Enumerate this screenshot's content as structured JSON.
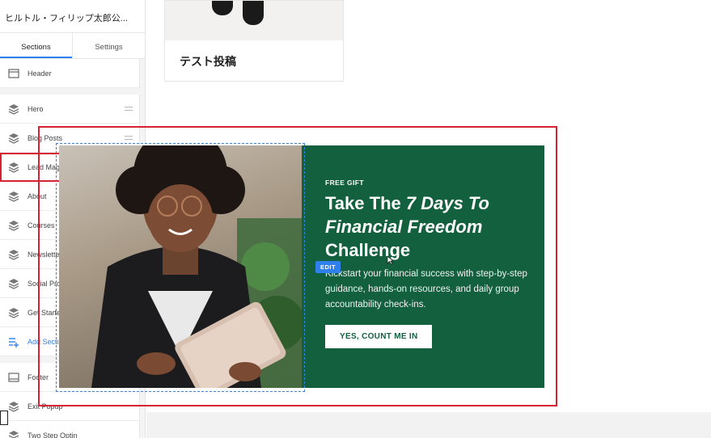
{
  "site": {
    "title": "ヒルトル・フィリップ太郎公..."
  },
  "tabs": [
    {
      "label": "Sections",
      "active": true
    },
    {
      "label": "Settings",
      "active": false
    }
  ],
  "sections": {
    "header": {
      "label": "Header"
    },
    "body": [
      {
        "label": "Hero",
        "hidden": false
      },
      {
        "label": "Blog Posts",
        "hidden": false
      },
      {
        "label": "Lead Magnet",
        "hidden": false,
        "selected": true
      },
      {
        "label": "About",
        "hidden": false
      },
      {
        "label": "Courses",
        "hidden": false
      },
      {
        "label": "Newsletter Opt-In",
        "hidden": false
      },
      {
        "label": "Social Proof Logos",
        "hidden": true
      },
      {
        "label": "Get Started",
        "hidden": true
      }
    ],
    "add_label": "Add Section",
    "footer": [
      {
        "label": "Footer"
      },
      {
        "label": "Exit Popup"
      },
      {
        "label": "Two Step Optin"
      }
    ]
  },
  "canvas": {
    "post_title": "テスト投稿",
    "lead_magnet": {
      "eyebrow": "FREE GIFT",
      "headline_plain_1": "Take The ",
      "headline_italic": "7 Days To Financial Freedom",
      "headline_plain_2": " Challenge",
      "description": "Kickstart your financial success with step-by-step guidance, hands-on resources, and daily group accountability check-ins.",
      "button": "YES, COUNT ME IN",
      "edit_badge": "EDIT"
    }
  },
  "colors": {
    "accent": "#2f80ed",
    "highlight": "#d62232",
    "lead_bg": "#13603f"
  }
}
